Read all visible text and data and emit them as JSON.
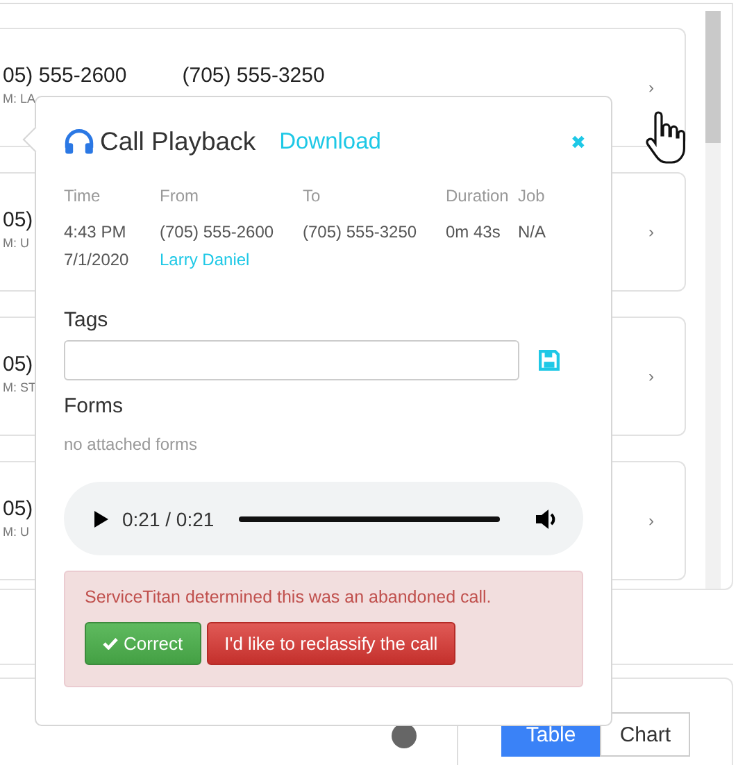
{
  "call_list": [
    {
      "from": "05) 555-2600",
      "to": "(705) 555-3250",
      "detail": "M: LA",
      "chevron": "›"
    },
    {
      "from": "05)",
      "detail": "M: U",
      "chevron": "›"
    },
    {
      "from": "05)",
      "detail": "M: ST",
      "chevron": "›"
    },
    {
      "from": "05)",
      "detail": "M: U",
      "chevron": "›"
    }
  ],
  "view_toggle": [
    {
      "label": "Table",
      "selected": true
    },
    {
      "label": "Chart",
      "selected": false
    }
  ],
  "popover": {
    "title": "Call Playback",
    "download": "Download",
    "close": "✖",
    "columns": [
      {
        "label": "Time",
        "values": [
          {
            "text": "4:43 PM",
            "kind": "text"
          },
          {
            "text": "7/1/2020",
            "kind": "text"
          }
        ]
      },
      {
        "label": "From",
        "values": [
          {
            "text": "(705) 555-2600",
            "kind": "text"
          },
          {
            "text": "Larry Daniel",
            "kind": "link"
          }
        ]
      },
      {
        "label": "To",
        "values": [
          {
            "text": "(705) 555-3250",
            "kind": "text"
          }
        ]
      },
      {
        "label": "Duration",
        "values": [
          {
            "text": "0m 43s",
            "kind": "text"
          }
        ]
      },
      {
        "label": "Job",
        "values": [
          {
            "text": "N/A",
            "kind": "text"
          }
        ]
      }
    ],
    "tags_label": "Tags",
    "forms_label": "Forms",
    "forms_empty": "no attached forms",
    "player": {
      "time": "0:21 / 0:21",
      "level": 1
    },
    "alert": {
      "message": "ServiceTitan determined this was an abandoned call.",
      "buttons": [
        {
          "label": "Correct",
          "kind": "success"
        },
        {
          "label": "I'd like to reclassify the call",
          "kind": "danger"
        }
      ]
    }
  }
}
